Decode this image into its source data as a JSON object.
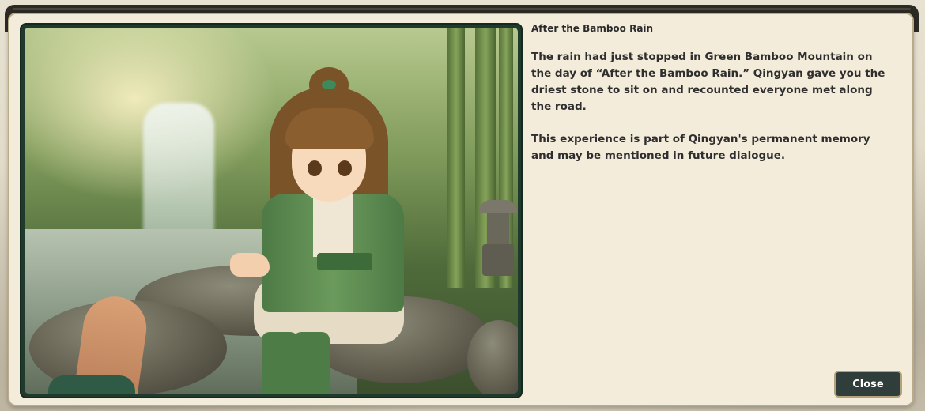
{
  "dialog": {
    "title": "After the Bamboo Rain",
    "paragraphs": [
      "The rain had just stopped in Green Bamboo Mountain on the day of “After the Bamboo Rain.” Qingyan gave you the driest stone to sit on and recounted everyone met along the road.",
      "This experience is part of Qingyan's permanent memory and may be mentioned in future dialogue."
    ],
    "close_label": "Close"
  },
  "colors": {
    "dialog_bg": "#f4ecda",
    "frame": "#1f3a2c",
    "button_bg": "#2f3e3a",
    "button_border": "#b3a27c"
  }
}
